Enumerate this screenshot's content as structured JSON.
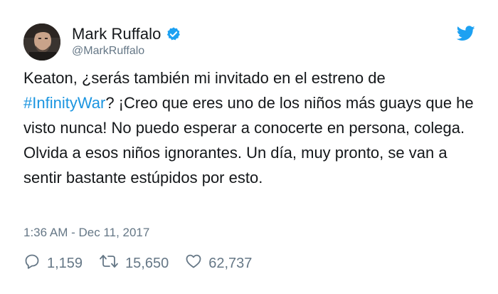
{
  "author": {
    "display_name": "Mark Ruffalo",
    "handle": "@MarkRuffalo",
    "verified": true
  },
  "tweet": {
    "text_before_hashtag": "Keaton, ¿serás también mi invitado en el estreno de ",
    "hashtag": "#InfinityWar",
    "text_after_hashtag": "? ¡Creo que eres uno de los niños más guays que he visto nunca! No puedo esperar a conocerte en persona, colega. Olvida a esos niños ignorantes. Un día, muy pronto, se van a sentir bastante estúpidos por esto.",
    "timestamp": "1:36 AM - Dec 11, 2017"
  },
  "actions": {
    "replies": "1,159",
    "retweets": "15,650",
    "likes": "62,737"
  },
  "colors": {
    "twitter_blue": "#1da1f2",
    "hashtag_blue": "#1b95e0",
    "secondary_text": "#657786",
    "primary_text": "#14171a"
  },
  "icons": {
    "reply": "reply-icon",
    "retweet": "retweet-icon",
    "like": "heart-icon",
    "brand": "twitter-bird-icon",
    "verified": "verified-badge-icon"
  }
}
